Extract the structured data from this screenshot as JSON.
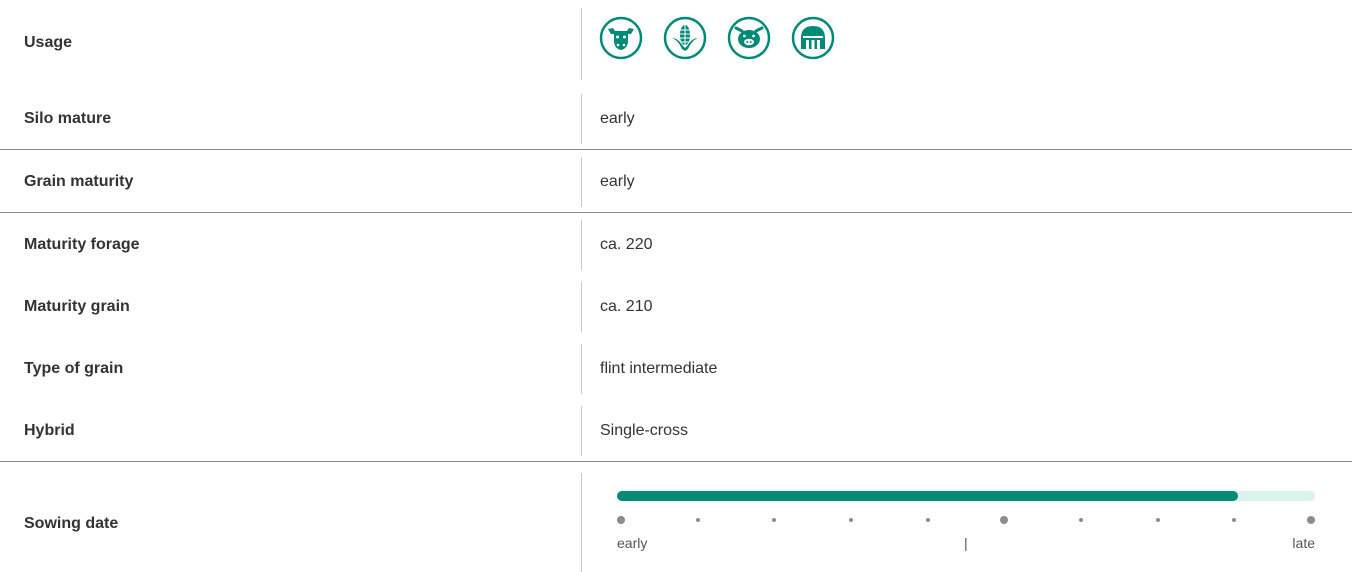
{
  "colors": {
    "accent": "#008a78",
    "track": "#d9f3ef",
    "divider": "#8a8a8a"
  },
  "rows": [
    {
      "label": "Usage",
      "icons": [
        "cow-icon",
        "corn-icon",
        "pig-icon",
        "silo-icon"
      ]
    },
    {
      "label": "Silo mature",
      "value": "early"
    },
    {
      "label": "Grain maturity",
      "value": "early"
    },
    {
      "label": "Maturity forage",
      "value": "ca. 220"
    },
    {
      "label": "Maturity grain",
      "value": "ca. 210"
    },
    {
      "label": "Type of grain",
      "value": "flint intermediate"
    },
    {
      "label": "Hybrid",
      "value": "Single-cross"
    },
    {
      "label": "Sowing date"
    }
  ],
  "sowing": {
    "fraction": 0.89,
    "early_label": "early",
    "mid_label": "|",
    "late_label": "late",
    "ticks": 10,
    "major_ticks": [
      0,
      5,
      9
    ]
  }
}
